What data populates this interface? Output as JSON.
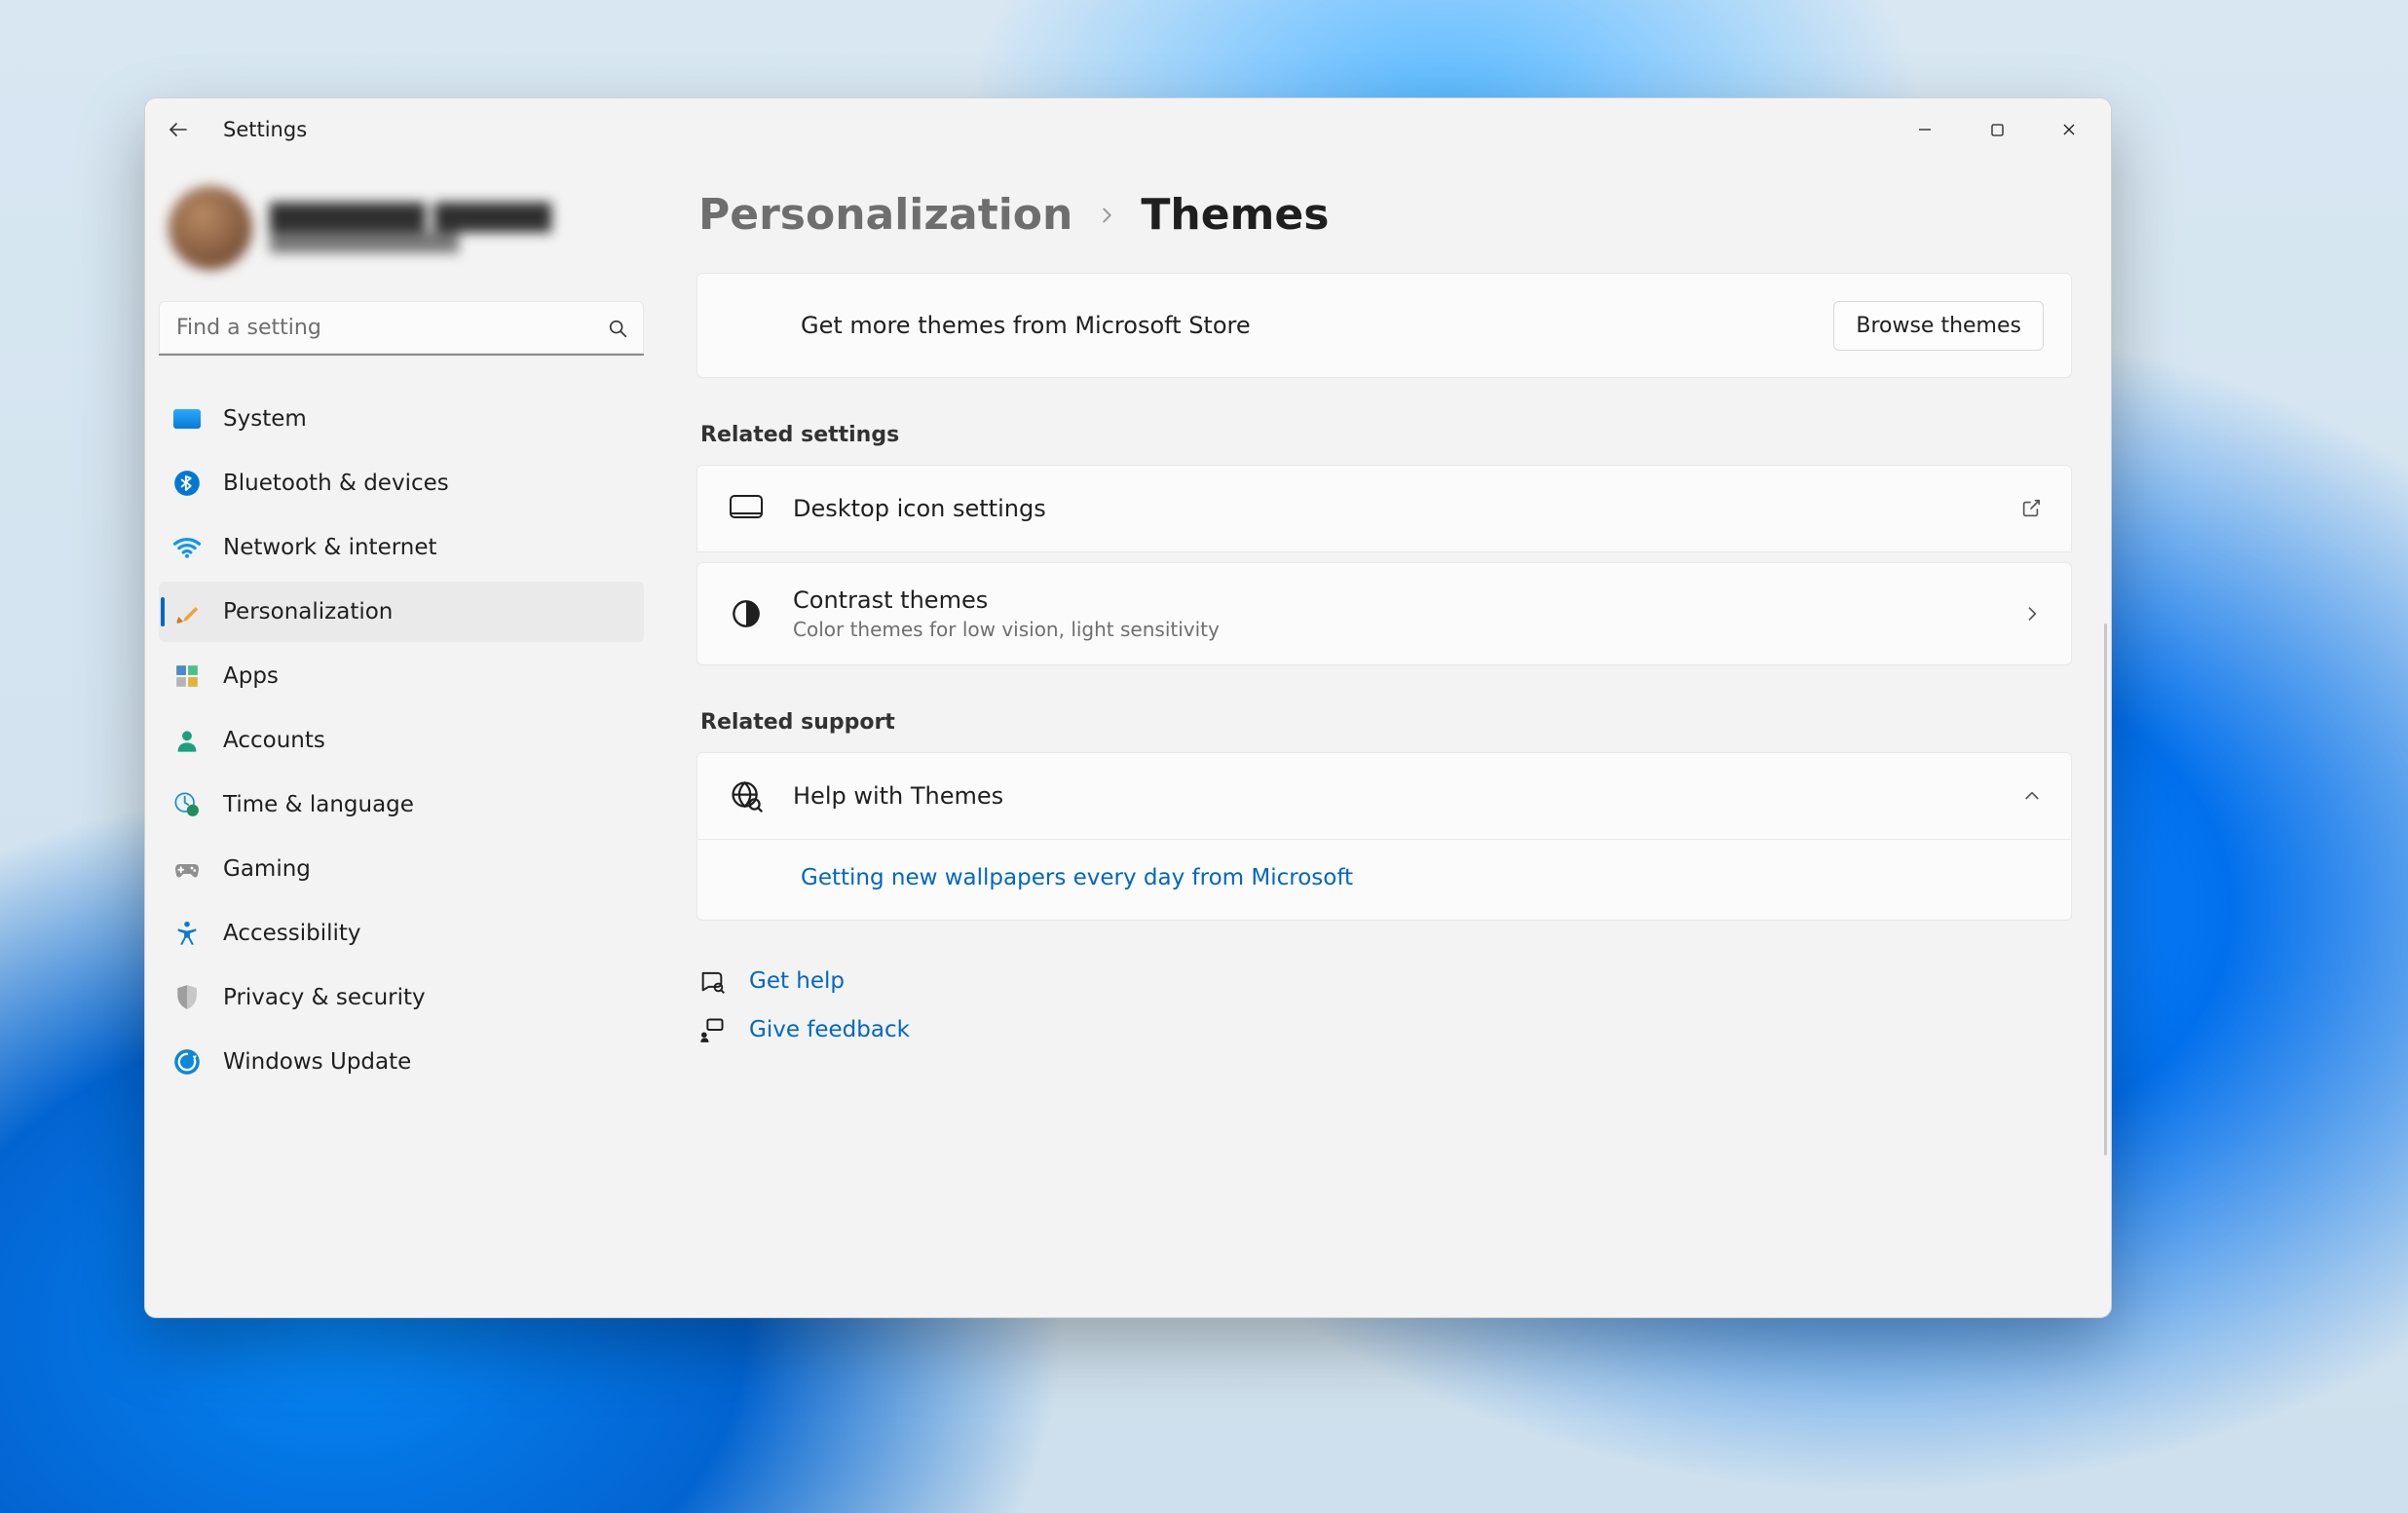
{
  "app": {
    "title": "Settings"
  },
  "search": {
    "placeholder": "Find a setting"
  },
  "sidebar": {
    "items": [
      {
        "label": "System"
      },
      {
        "label": "Bluetooth & devices"
      },
      {
        "label": "Network & internet"
      },
      {
        "label": "Personalization"
      },
      {
        "label": "Apps"
      },
      {
        "label": "Accounts"
      },
      {
        "label": "Time & language"
      },
      {
        "label": "Gaming"
      },
      {
        "label": "Accessibility"
      },
      {
        "label": "Privacy & security"
      },
      {
        "label": "Windows Update"
      }
    ],
    "selected_index": 3
  },
  "breadcrumb": {
    "parent": "Personalization",
    "current": "Themes"
  },
  "store": {
    "text": "Get more themes from Microsoft Store",
    "button": "Browse themes"
  },
  "sections": {
    "related_settings": {
      "title": "Related settings",
      "items": [
        {
          "title": "Desktop icon settings"
        },
        {
          "title": "Contrast themes",
          "subtitle": "Color themes for low vision, light sensitivity"
        }
      ]
    },
    "related_support": {
      "title": "Related support",
      "item": {
        "title": "Help with Themes"
      },
      "expanded_link": "Getting new wallpapers every day from Microsoft"
    }
  },
  "footer": {
    "get_help": "Get help",
    "give_feedback": "Give feedback"
  }
}
